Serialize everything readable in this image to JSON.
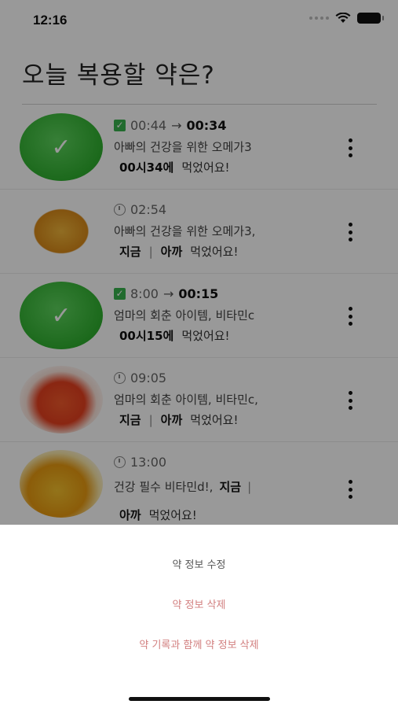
{
  "status_bar": {
    "time": "12:16"
  },
  "page": {
    "title": "오늘 복용할 약은?"
  },
  "medications": [
    {
      "state": "taken",
      "scheduled_time": "00:44",
      "taken_time": "00:34",
      "name": "아빠의 건강을 위한 오메가3",
      "taken_message": "00시34에",
      "suffix": "먹었어요!"
    },
    {
      "state": "pending",
      "scheduled_time": "02:54",
      "name": "아빠의 건강을 위한 오메가3,",
      "option_now": "지금",
      "separator": "|",
      "option_before": "아까",
      "suffix": "먹었어요!"
    },
    {
      "state": "taken",
      "scheduled_time": "8:00",
      "taken_time": "00:15",
      "name": "엄마의 회춘 아이템, 비타민c",
      "taken_message": "00시15에",
      "suffix": "먹었어요!"
    },
    {
      "state": "pending",
      "scheduled_time": "09:05",
      "name": "엄마의 회춘 아이템, 비타민c,",
      "option_now": "지금",
      "separator": "|",
      "option_before": "아까",
      "suffix": "먹었어요!"
    },
    {
      "state": "pending",
      "scheduled_time": "13:00",
      "name": "건강 필수 비타민d!,",
      "option_now": "지금",
      "separator": "|",
      "option_before": "아까",
      "suffix": "먹었어요!"
    }
  ],
  "action_sheet": {
    "edit_label": "약 정보 수정",
    "delete_label": "약 정보 삭제",
    "delete_with_records_label": "약 기록과 함께 약 정보 삭제"
  },
  "icons": {
    "check": "check-icon",
    "clock": "clock-icon",
    "more": "more-vertical-icon"
  },
  "colors": {
    "taken_green": "#37b24d",
    "destructive": "#d27f7f"
  }
}
